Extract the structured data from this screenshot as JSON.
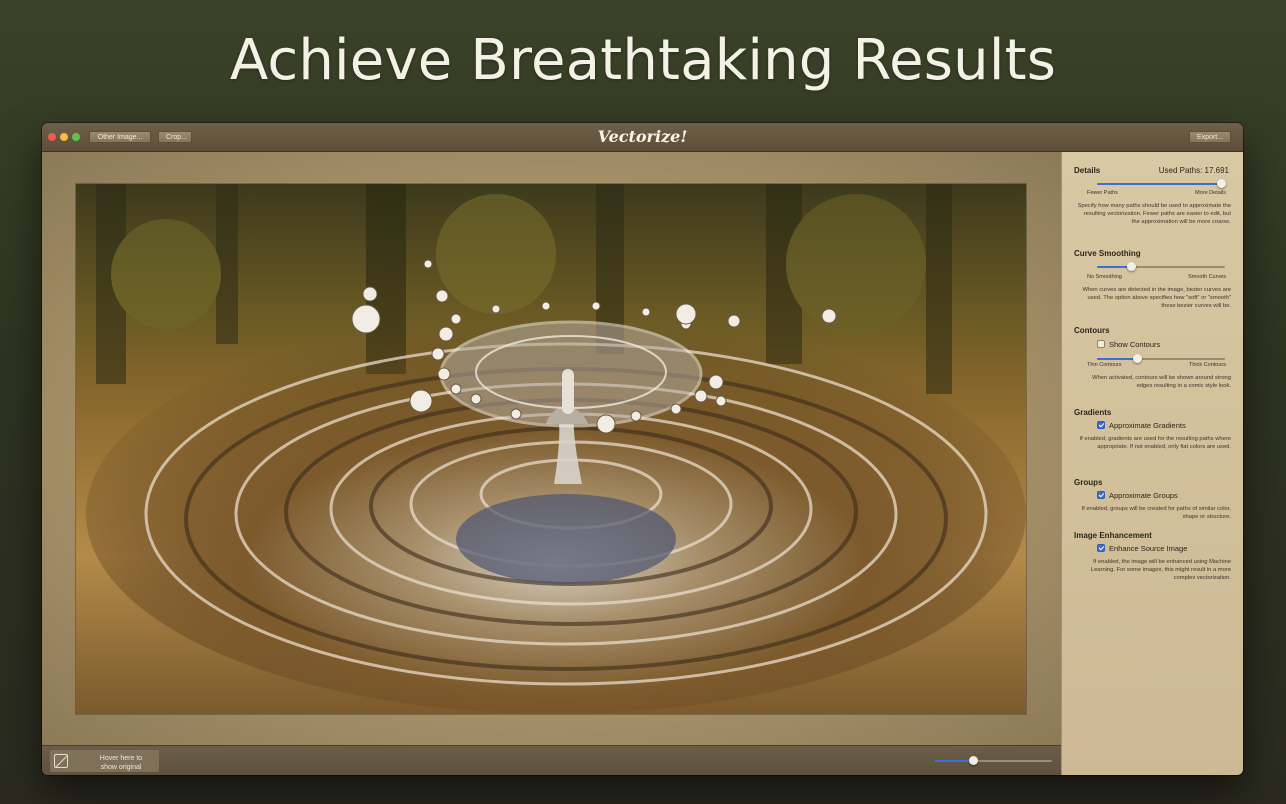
{
  "headline": "Achieve Breathtaking Results",
  "window": {
    "title": "Vectorize!",
    "buttons": {
      "other_image": "Other Image...",
      "crop": "Crop...",
      "export": "Export..."
    },
    "traffic_lights": {
      "close": "#ee5b52",
      "minimize": "#f3bd3f",
      "zoom": "#5fc24c"
    }
  },
  "canvas": {
    "image_subject": "water droplet splash photo (vectorized)"
  },
  "bottombar": {
    "hover_text_line1": "Hover here to",
    "hover_text_line2": "show original",
    "hover_icon": "compare-icon",
    "zoom_level": 0.33
  },
  "sidebar": {
    "details": {
      "title": "Details",
      "used_paths": "Used Paths: 17.691",
      "slider_value": 0.97,
      "min_label": "Fewer Paths",
      "max_label": "More Details",
      "description": "Specify how many paths should be used to approximate the resulting vectorization. Fewer paths are easier to edit, but the approximation will be more coarse."
    },
    "curve_smoothing": {
      "title": "Curve Smoothing",
      "slider_value": 0.27,
      "min_label": "No Smoothing",
      "max_label": "Smooth Curves",
      "description": "When curves are detected in the image, bezier curves are used. The option above specifies how \"soft\" or \"smooth\" these bezier curves will be."
    },
    "contours": {
      "title": "Contours",
      "checkbox_label": "Show Contours",
      "checked": false,
      "slider_value": 0.32,
      "min_label": "Thin Contours",
      "max_label": "Thick Contours",
      "description": "When activated, contours will be shown around strong edges resulting in a comic style look."
    },
    "gradients": {
      "title": "Gradients",
      "checkbox_label": "Approximate Gradients",
      "checked": true,
      "description": "If enabled, gradients are used for the resulting paths where appropriate. If not enabled, only flat colors are used."
    },
    "groups": {
      "title": "Groups",
      "checkbox_label": "Approximate Groups",
      "checked": true,
      "description": "If enabled, groups will be created for paths of similar color, shape or structure."
    },
    "image_enhancement": {
      "title": "Image Enhancement",
      "checkbox_label": "Enhance Source Image",
      "checked": true,
      "description": "If enabled, the image will be enhanced using Machine Learning. For some images, this might result in a more complex vectorization."
    }
  },
  "colors": {
    "accent": "#3b6fd6",
    "background_top": "#3a4228",
    "sidebar": "#d6c49f"
  }
}
